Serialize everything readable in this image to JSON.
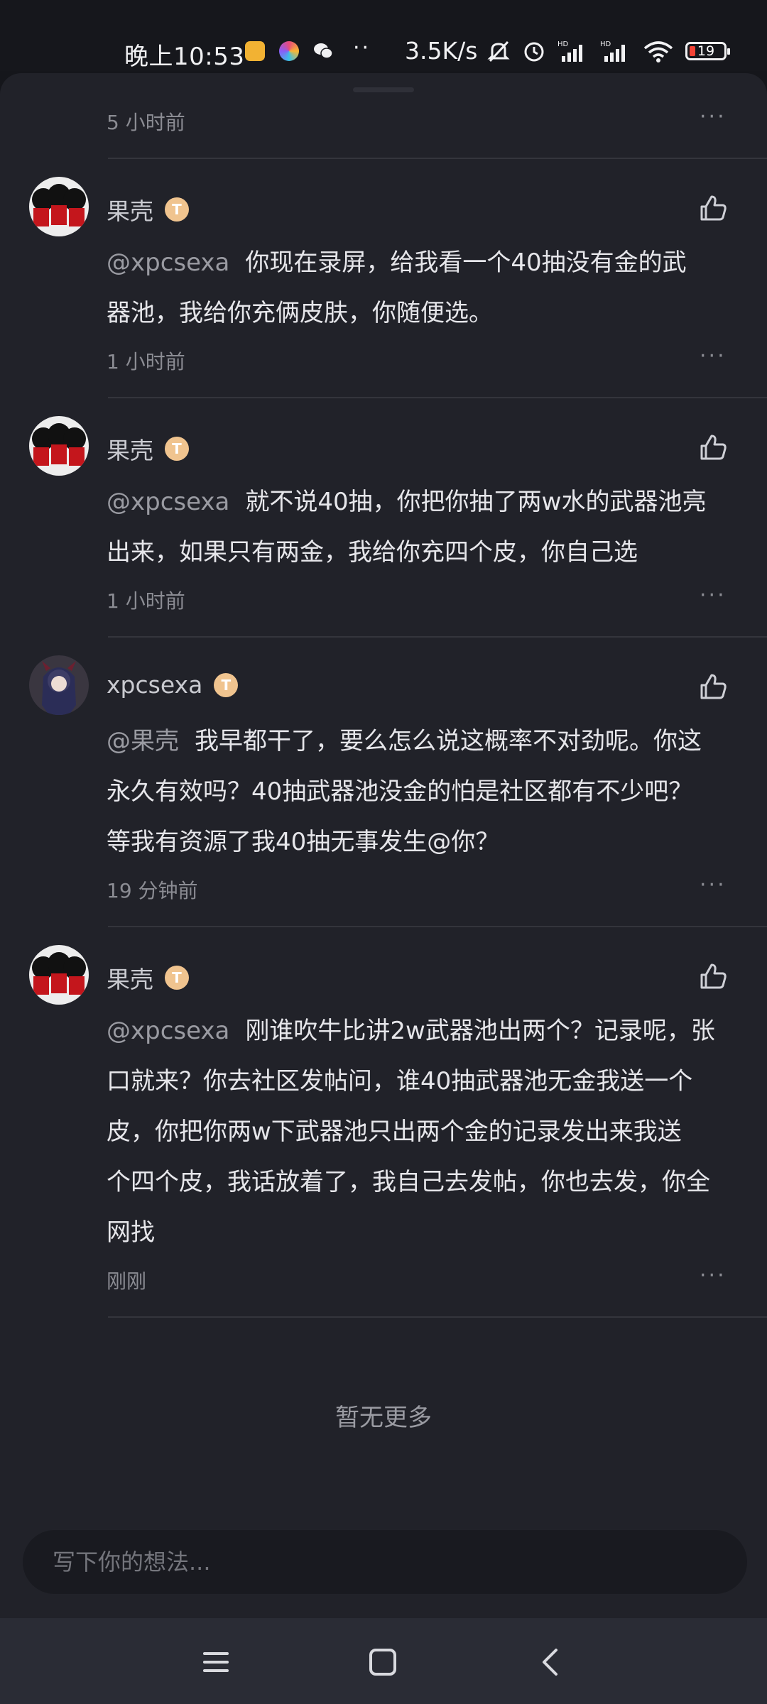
{
  "status_bar": {
    "time": "晚上10:53",
    "dots": "··",
    "net_speed": "3.5K/s",
    "battery_level": "19",
    "app_icons": [
      "photo-app-icon",
      "camera-app-icon",
      "wechat-icon"
    ],
    "system_icons": [
      "mute-bell-icon",
      "alarm-icon",
      "signal-hd-icon",
      "signal-hd-icon",
      "wifi-icon",
      "battery-icon"
    ]
  },
  "top_item": {
    "time": "5 小时前",
    "more": "···"
  },
  "comments": [
    {
      "user": "果壳",
      "badge": "T",
      "mention": "@xpcsexa",
      "lines": [
        "你现在录屏，给我看一个40抽没有金的武",
        "器池，我给你充俩皮肤，你随便选。"
      ],
      "time": "1 小时前",
      "more": "···"
    },
    {
      "user": "果壳",
      "badge": "T",
      "mention": "@xpcsexa",
      "lines": [
        "就不说40抽，你把你抽了两w水的武器池亮",
        "出来，如果只有两金，我给你充四个皮，你自己选"
      ],
      "time": "1 小时前",
      "more": "···"
    },
    {
      "user": "xpcsexa",
      "badge": "T",
      "mention": "@果壳",
      "lines": [
        "我早都干了，要么怎么说这概率不对劲呢。你这",
        "永久有效吗？40抽武器池没金的怕是社区都有不少吧？",
        "等我有资源了我40抽无事发生@你？"
      ],
      "time": "19 分钟前",
      "more": "···"
    },
    {
      "user": "果壳",
      "badge": "T",
      "mention": "@xpcsexa",
      "lines": [
        "刚谁吹牛比讲2w武器池出两个？记录呢，张",
        "口就来？你去社区发帖问，谁40抽武器池无金我送一个",
        "皮，你把你两w下武器池只出两个金的记录发出来我送",
        "个四个皮，我话放着了，我自己去发帖，你也去发，你全",
        "网找"
      ],
      "time": "刚刚",
      "more": "···"
    }
  ],
  "no_more": "暂无更多",
  "input": {
    "placeholder": "写下你的想法..."
  },
  "nav": [
    "menu-icon",
    "home-icon",
    "back-icon"
  ],
  "colors": {
    "background": "#212229",
    "text": "#e6e6ea",
    "muted": "#8b8c93",
    "badge": "#f0c48f"
  }
}
